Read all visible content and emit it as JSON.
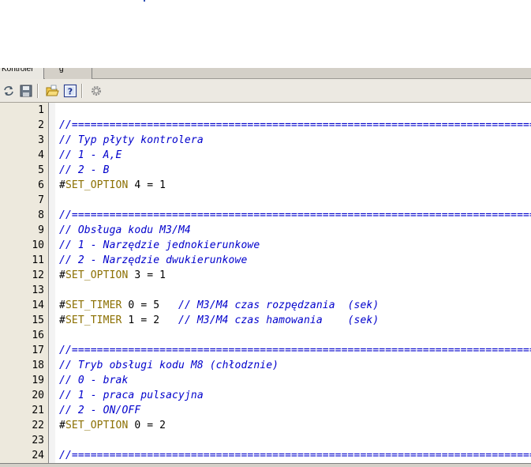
{
  "tabs": [
    {
      "label": "Kontroler"
    },
    {
      "label": "g"
    }
  ],
  "toolbar": {
    "buttons": [
      {
        "icon": "refresh-icon"
      },
      {
        "icon": "save-icon"
      },
      {
        "icon": "open-folder-icon"
      },
      {
        "icon": "help-icon"
      },
      {
        "icon": "gear-icon"
      }
    ]
  },
  "editor": {
    "lines": [
      {
        "num": "1",
        "parts": []
      },
      {
        "num": "2",
        "parts": [
          {
            "t": "cmt",
            "v": "//=============================================================================="
          }
        ]
      },
      {
        "num": "3",
        "parts": [
          {
            "t": "cmt",
            "v": "// Typ płyty kontrolera"
          }
        ]
      },
      {
        "num": "4",
        "parts": [
          {
            "t": "cmt",
            "v": "// 1 - A,E"
          }
        ]
      },
      {
        "num": "5",
        "parts": [
          {
            "t": "cmt",
            "v": "// 2 - B"
          }
        ]
      },
      {
        "num": "6",
        "parts": [
          {
            "t": "hash",
            "v": "#"
          },
          {
            "t": "kw",
            "v": "SET_OPTION"
          },
          {
            "t": "plain",
            "v": " 4 = 1"
          }
        ]
      },
      {
        "num": "7",
        "parts": []
      },
      {
        "num": "8",
        "parts": [
          {
            "t": "cmt",
            "v": "//=============================================================================="
          }
        ]
      },
      {
        "num": "9",
        "parts": [
          {
            "t": "cmt",
            "v": "// Obsługa kodu M3/M4"
          }
        ]
      },
      {
        "num": "10",
        "parts": [
          {
            "t": "cmt",
            "v": "// 1 - Narzędzie jednokierunkowe"
          }
        ]
      },
      {
        "num": "11",
        "parts": [
          {
            "t": "cmt",
            "v": "// 2 - Narzędzie dwukierunkowe"
          }
        ]
      },
      {
        "num": "12",
        "parts": [
          {
            "t": "hash",
            "v": "#"
          },
          {
            "t": "kw",
            "v": "SET_OPTION"
          },
          {
            "t": "plain",
            "v": " 3 = 1"
          }
        ]
      },
      {
        "num": "13",
        "parts": []
      },
      {
        "num": "14",
        "parts": [
          {
            "t": "hash",
            "v": "#"
          },
          {
            "t": "kw",
            "v": "SET_TIMER"
          },
          {
            "t": "plain",
            "v": " 0 = 5   "
          },
          {
            "t": "cmt",
            "v": "// M3/M4 czas rozpędzania  (sek)"
          }
        ]
      },
      {
        "num": "15",
        "parts": [
          {
            "t": "hash",
            "v": "#"
          },
          {
            "t": "kw",
            "v": "SET_TIMER"
          },
          {
            "t": "plain",
            "v": " 1 = 2   "
          },
          {
            "t": "cmt",
            "v": "// M3/M4 czas hamowania    (sek)"
          }
        ]
      },
      {
        "num": "16",
        "parts": []
      },
      {
        "num": "17",
        "parts": [
          {
            "t": "cmt",
            "v": "//=============================================================================="
          }
        ]
      },
      {
        "num": "18",
        "parts": [
          {
            "t": "cmt",
            "v": "// Tryb obsługi kodu M8 (chłodznie)"
          }
        ]
      },
      {
        "num": "19",
        "parts": [
          {
            "t": "cmt",
            "v": "// 0 - brak"
          }
        ]
      },
      {
        "num": "20",
        "parts": [
          {
            "t": "cmt",
            "v": "// 1 - praca pulsacyjna"
          }
        ]
      },
      {
        "num": "21",
        "parts": [
          {
            "t": "cmt",
            "v": "// 2 - ON/OFF"
          }
        ]
      },
      {
        "num": "22",
        "parts": [
          {
            "t": "hash",
            "v": "#"
          },
          {
            "t": "kw",
            "v": "SET_OPTION"
          },
          {
            "t": "plain",
            "v": " 0 = 2"
          }
        ]
      },
      {
        "num": "23",
        "parts": []
      },
      {
        "num": "24",
        "parts": [
          {
            "t": "cmt",
            "v": "//=============================================================================="
          }
        ]
      }
    ]
  }
}
